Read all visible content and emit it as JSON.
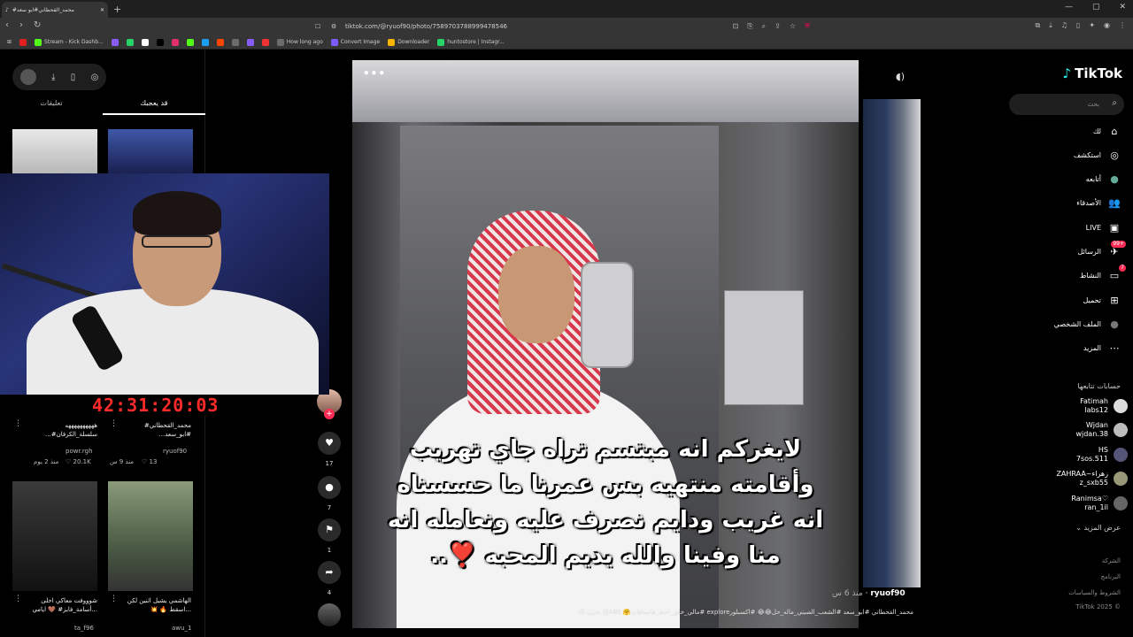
{
  "browser": {
    "tab_title": "محمد_القحطاني#ابو سعد#",
    "url": "tiktok.com/@ryuof90/photo/7589703788999478546",
    "bookmarks": [
      {
        "label": "",
        "color": "#e02020"
      },
      {
        "label": "Stream - Kick Dashb...",
        "color": "#53fc18"
      },
      {
        "label": "",
        "color": "#8a5cf6"
      },
      {
        "label": "",
        "color": "#25d366"
      },
      {
        "label": "",
        "color": "#ffffff"
      },
      {
        "label": "",
        "color": "#000000"
      },
      {
        "label": "",
        "color": "#e1306c"
      },
      {
        "label": "",
        "color": "#53fc18"
      },
      {
        "label": "",
        "color": "#1da1f2"
      },
      {
        "label": "",
        "color": "#ff4500"
      },
      {
        "label": "",
        "color": "#6c6c6c"
      },
      {
        "label": "",
        "color": "#8a5cf6"
      },
      {
        "label": "",
        "color": "#e33"
      },
      {
        "label": "How long ago",
        "color": "#6c6c6c"
      },
      {
        "label": "Convert Image",
        "color": "#7c5cff"
      },
      {
        "label": "Downloader",
        "color": "#f5b400"
      },
      {
        "label": "huntostore | Instagr...",
        "color": "#25d366"
      }
    ]
  },
  "left_panel": {
    "tabs": [
      "تعليقات",
      "قد يعجبك"
    ],
    "timer": "42:31:20:03",
    "cards": [
      {
        "title": "محمد_القحطاني#\n#ابو_سعد...",
        "user": "ryuof90",
        "count": "13",
        "age": "منذ 9 س"
      },
      {
        "title": "ههههههههههه\nسلسلة_الكرفان#...",
        "user": "powr.rgh",
        "count": "20.1K",
        "age": "منذ 2 يوم"
      },
      {
        "title": "الهاشمي يشيل اثنين لكن\n...اسقط 🔥 💥",
        "user": "awu_1",
        "count": "",
        "age": ""
      },
      {
        "title": "شوووفت معاكي احلى\n...أسامة_فايز# 🤎 ايامي",
        "user": "ta_f96",
        "count": "",
        "age": ""
      }
    ]
  },
  "video": {
    "caption_lines": [
      "لايغركم انه مبتسم تراه جاي تهريب",
      "وأقامته منتهيه بس عمرنا ما حسسناه",
      "انه غريب ودايم نصرف عليه ونعامله انه",
      "منا وفينا والله يديم المحبه ❣️.."
    ],
    "author": "ryuof90",
    "age": "منذ 6 س",
    "description": "محمد_القحطاني #ابو_سعد #الشعب_الصيني_ماله_حل😂😂 #اكسبلورexplore #مالي_خلق_احط_هاشتاقات🤗 ABS@ يحزن 😔",
    "likes": "17",
    "comments": "7",
    "saves": "1",
    "shares": "4"
  },
  "sidebar": {
    "logo": "TikTok",
    "search_placeholder": "بحث",
    "nav": [
      {
        "label": "لك",
        "icon": "home-icon",
        "glyph": "⌂"
      },
      {
        "label": "استكشف",
        "icon": "compass-icon",
        "glyph": "◎"
      },
      {
        "label": "أتابعه",
        "icon": "following-avatar-icon",
        "glyph": "●"
      },
      {
        "label": "الأصدقاء",
        "icon": "friends-icon",
        "glyph": "👥"
      },
      {
        "label": "LIVE",
        "icon": "live-icon",
        "glyph": "▣"
      },
      {
        "label": "الرسائل",
        "icon": "messages-icon",
        "glyph": "✈",
        "badge": "99+"
      },
      {
        "label": "النشاط",
        "icon": "activity-icon",
        "glyph": "▭",
        "badge": "7"
      },
      {
        "label": "تحميل",
        "icon": "upload-icon",
        "glyph": "⊞"
      },
      {
        "label": "الملف الشخصي",
        "icon": "profile-icon",
        "glyph": "●"
      },
      {
        "label": "المزيد",
        "icon": "more-icon",
        "glyph": "⋯"
      }
    ],
    "following_header": "حسابات تتابعها",
    "following": [
      {
        "name": "Fatimah",
        "handle": "labs12"
      },
      {
        "name": "Wjdan",
        "handle": "wjdan.38"
      },
      {
        "name": "HS",
        "handle": "7sos.511"
      },
      {
        "name": "ZAHRAA~زهراء",
        "handle": "z_sxb55"
      },
      {
        "name": "Ranimsa♡",
        "handle": "ran_1il"
      }
    ],
    "show_more": "عرض المزيد",
    "footer": [
      "الشركة",
      "البرنامج",
      "الشروط والسياسات",
      "TikTok 2025 ©"
    ]
  }
}
